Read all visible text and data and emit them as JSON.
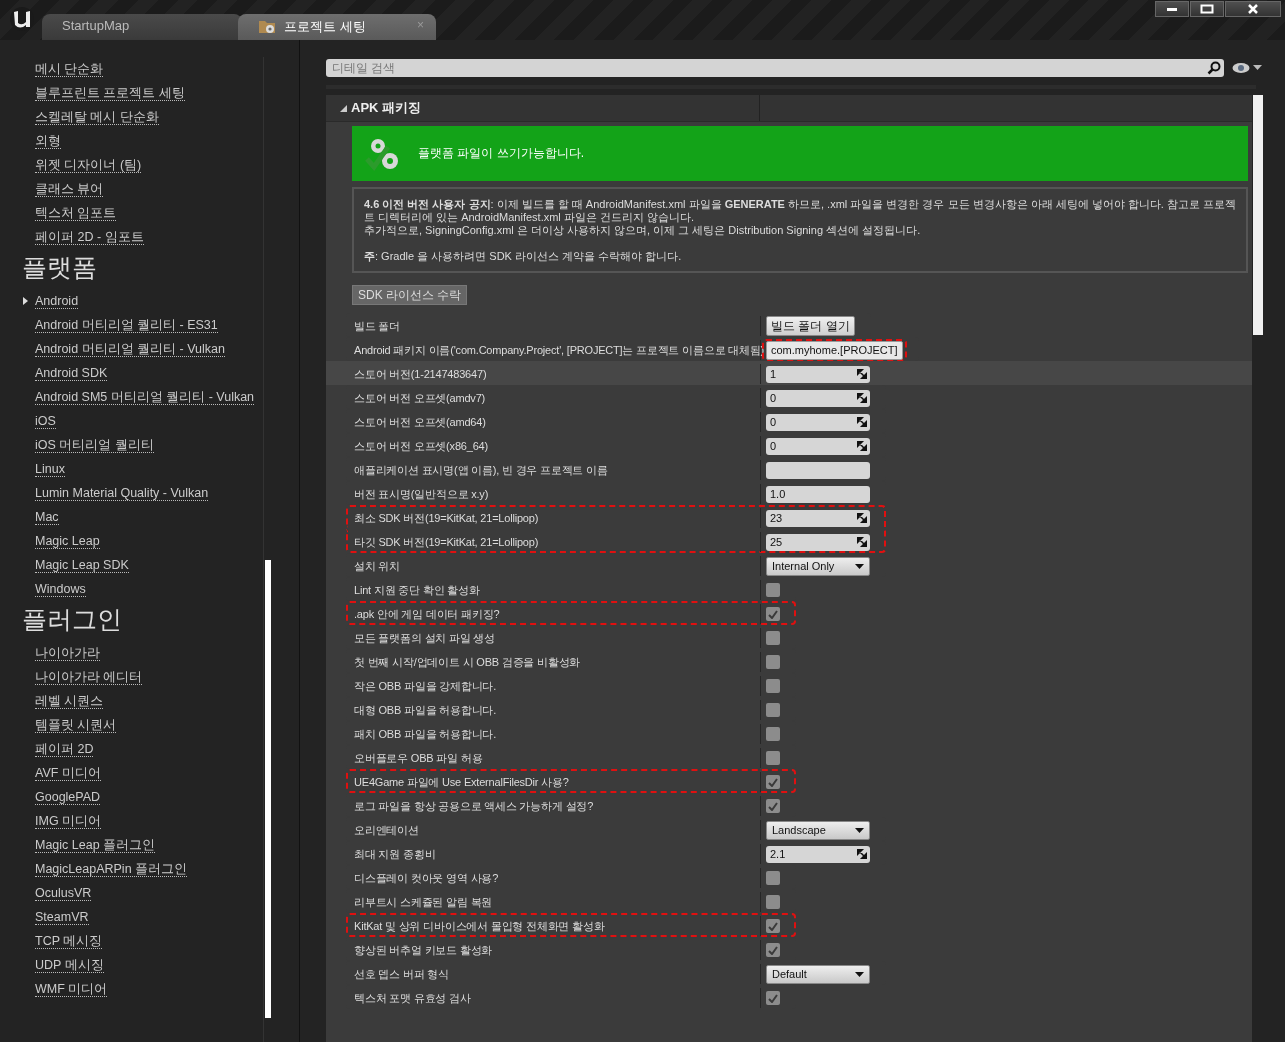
{
  "title_bar": {
    "tabs": [
      {
        "label": "StartupMap",
        "selected": false
      },
      {
        "label": "프로젝트 세팅",
        "selected": true,
        "close_label": "×"
      }
    ]
  },
  "sidebar": {
    "groups": [
      {
        "items": [
          {
            "label": "메시 단순화",
            "kind": "link"
          },
          {
            "label": "블루프린트 프로젝트 세팅",
            "kind": "link"
          },
          {
            "label": "스켈레탈 메시 단순화",
            "kind": "link"
          },
          {
            "label": "외형",
            "kind": "link"
          },
          {
            "label": "위젯 디자이너 (팀)",
            "kind": "link"
          },
          {
            "label": "클래스 뷰어",
            "kind": "link"
          },
          {
            "label": "텍스처 임포트",
            "kind": "link"
          },
          {
            "label": "페이퍼 2D - 임포트",
            "kind": "link"
          }
        ]
      },
      {
        "heading": "플랫폼",
        "items": [
          {
            "label": "Android",
            "kind": "expandable"
          },
          {
            "label": "Android 머티리얼 퀄리티 - ES31",
            "kind": "link"
          },
          {
            "label": "Android 머티리얼 퀄리티 - Vulkan",
            "kind": "link"
          },
          {
            "label": "Android SDK",
            "kind": "link"
          },
          {
            "label": "Android SM5 머티리얼 퀄리티 - Vulkan",
            "kind": "link"
          },
          {
            "label": "iOS",
            "kind": "link"
          },
          {
            "label": "iOS 머티리얼 퀄리티",
            "kind": "link"
          },
          {
            "label": "Linux",
            "kind": "link"
          },
          {
            "label": "Lumin Material Quality - Vulkan",
            "kind": "link"
          },
          {
            "label": "Mac",
            "kind": "link"
          },
          {
            "label": "Magic Leap",
            "kind": "link"
          },
          {
            "label": "Magic Leap SDK",
            "kind": "link"
          },
          {
            "label": "Windows",
            "kind": "link"
          }
        ]
      },
      {
        "heading": "플러그인",
        "items": [
          {
            "label": "나이아가라",
            "kind": "link"
          },
          {
            "label": "나이아가라 에디터",
            "kind": "link"
          },
          {
            "label": "레벨 시퀀스",
            "kind": "link"
          },
          {
            "label": "템플릿 시퀀서",
            "kind": "link"
          },
          {
            "label": "페이퍼 2D",
            "kind": "link"
          },
          {
            "label": "AVF 미디어",
            "kind": "link"
          },
          {
            "label": "GooglePAD",
            "kind": "link"
          },
          {
            "label": "IMG 미디어",
            "kind": "link"
          },
          {
            "label": "Magic Leap 플러그인",
            "kind": "link"
          },
          {
            "label": "MagicLeapARPin 플러그인",
            "kind": "link"
          },
          {
            "label": "OculusVR",
            "kind": "link"
          },
          {
            "label": "SteamVR",
            "kind": "link"
          },
          {
            "label": "TCP 메시징",
            "kind": "link"
          },
          {
            "label": "UDP 메시징",
            "kind": "link"
          },
          {
            "label": "WMF 미디어",
            "kind": "link"
          }
        ]
      }
    ]
  },
  "details": {
    "search": {
      "placeholder": "디테일 검색"
    },
    "category": {
      "label": "APK 패키징",
      "expanded": true
    },
    "banner": {
      "text": "플랫폼 파일이 쓰기가능합니다."
    },
    "notice": [
      "**4.6 이전 버전 사용자 공지**: 이제 빌드를 할 때 AndroidManifest.xml 파일을 **GENERATE** 하므로, .xml 파일을 변경한 경우 모든 변경사항은 아래 세팅에 넣어야 합니다. 참고로 프로젝트 디렉터리에 있는 AndroidManifest.xml 파일은 건드리지 않습니다.",
      "추가적으로, SigningConfig.xml 은 더이상 사용하지 않으며, 이제 그 세팅은 Distribution Signing 섹션에 설정됩니다.",
      "**주**: Gradle 을 사용하려면 SDK 라이선스 계약을 수락해야 합니다."
    ],
    "license_button": "SDK 라이선스 수락",
    "rows": [
      {
        "kind": "button",
        "label": "빌드 폴더",
        "value": "빌드 폴더 열기",
        "value_highlighted": false,
        "row_highlighted": false,
        "hovered": false
      },
      {
        "kind": "text",
        "label": "Android 패키지 이름('com.Company.Project', [PROJECT]는 프로젝트 이름으로 대체됨)",
        "value": "com.myhome.[PROJECT]",
        "value_highlighted": true,
        "row_highlighted": false,
        "hovered": false
      },
      {
        "kind": "number",
        "label": "스토어 버전(1-2147483647)",
        "value": "1",
        "value_highlighted": false,
        "row_highlighted": false,
        "hovered": true
      },
      {
        "kind": "number",
        "label": "스토어 버전 오프셋(amdv7)",
        "value": "0",
        "value_highlighted": false,
        "row_highlighted": false,
        "hovered": false
      },
      {
        "kind": "number",
        "label": "스토어 버전 오프셋(amd64)",
        "value": "0",
        "value_highlighted": false,
        "row_highlighted": false,
        "hovered": false
      },
      {
        "kind": "number",
        "label": "스토어 버전 오프셋(x86_64)",
        "value": "0",
        "value_highlighted": false,
        "row_highlighted": false,
        "hovered": false
      },
      {
        "kind": "text",
        "label": "애플리케이션 표시명(앱 이름), 빈 경우 프로젝트 이름",
        "value_highlighted": false,
        "row_highlighted": false,
        "hovered": false
      },
      {
        "kind": "text",
        "label": "버전 표시명(일반적으로 x.y)",
        "value": "1.0",
        "value_highlighted": false,
        "row_highlighted": false,
        "hovered": false
      },
      {
        "kind": "number",
        "label": "최소 SDK 버전(19=KitKat, 21=Lollipop)",
        "value": "23",
        "value_highlighted": false,
        "row_highlighted": true,
        "hovered": false
      },
      {
        "kind": "number",
        "label": "타깃 SDK 버전(19=KitKat, 21=Lollipop)",
        "value": "25",
        "value_highlighted": false,
        "row_highlighted": true,
        "hovered": false
      },
      {
        "kind": "dropdown",
        "label": "설치 위치",
        "value": "Internal Only",
        "value_highlighted": false,
        "row_highlighted": false,
        "hovered": false
      },
      {
        "kind": "checkbox",
        "label": "Lint 지원 중단 확인 활성화",
        "checked": false,
        "value_highlighted": false,
        "row_highlighted": false,
        "hovered": false
      },
      {
        "kind": "checkbox",
        "label": ".apk 안에 게임 데이터 패키징?",
        "checked": true,
        "value_highlighted": false,
        "row_highlighted": true,
        "hovered": false
      },
      {
        "kind": "checkbox",
        "label": "모든 플랫폼의 설치 파일 생성",
        "checked": false,
        "value_highlighted": false,
        "row_highlighted": false,
        "hovered": false
      },
      {
        "kind": "checkbox",
        "label": "첫 번째 시작/업데이트 시 OBB 검증을 비활성화",
        "checked": false,
        "value_highlighted": false,
        "row_highlighted": false,
        "hovered": false
      },
      {
        "kind": "checkbox",
        "label": "작은 OBB 파일을 강제합니다.",
        "checked": false,
        "value_highlighted": false,
        "row_highlighted": false,
        "hovered": false
      },
      {
        "kind": "checkbox",
        "label": "대형 OBB 파일을 허용합니다.",
        "checked": false,
        "value_highlighted": false,
        "row_highlighted": false,
        "hovered": false
      },
      {
        "kind": "checkbox",
        "label": "패치 OBB 파일을 허용합니다.",
        "checked": false,
        "value_highlighted": false,
        "row_highlighted": false,
        "hovered": false
      },
      {
        "kind": "checkbox",
        "label": "오버플로우 OBB 파일 허용",
        "checked": false,
        "value_highlighted": false,
        "row_highlighted": false,
        "hovered": false
      },
      {
        "kind": "checkbox",
        "label": "UE4Game 파일에 Use ExternalFilesDir 사용?",
        "checked": true,
        "value_highlighted": false,
        "row_highlighted": true,
        "hovered": false
      },
      {
        "kind": "checkbox",
        "label": "로그 파일을 항상 공용으로 액세스 가능하게 설정?",
        "checked": true,
        "value_highlighted": false,
        "row_highlighted": false,
        "hovered": false
      },
      {
        "kind": "dropdown",
        "label": "오리엔테이션",
        "value": "Landscape",
        "value_highlighted": false,
        "row_highlighted": false,
        "hovered": false
      },
      {
        "kind": "number",
        "label": "최대 지원 종횡비",
        "value": "2.1",
        "value_highlighted": false,
        "row_highlighted": false,
        "hovered": false
      },
      {
        "kind": "checkbox",
        "label": "디스플레이 컷아웃 영역 사용?",
        "checked": false,
        "value_highlighted": false,
        "row_highlighted": false,
        "hovered": false
      },
      {
        "kind": "checkbox",
        "label": "리부트시 스케쥴된 알림 복원",
        "checked": false,
        "value_highlighted": false,
        "row_highlighted": false,
        "hovered": false
      },
      {
        "kind": "checkbox",
        "label": "KitKat 및 상위 디바이스에서 몰입형 전체화면 활성화",
        "checked": true,
        "value_highlighted": false,
        "row_highlighted": true,
        "hovered": false
      },
      {
        "kind": "checkbox",
        "label": "향상된 버추얼 키보드 활성화",
        "checked": true,
        "value_highlighted": false,
        "row_highlighted": false,
        "hovered": false
      },
      {
        "kind": "dropdown",
        "label": "선호 뎁스 버퍼 형식",
        "value": "Default",
        "value_highlighted": false,
        "row_highlighted": false,
        "hovered": false
      },
      {
        "kind": "checkbox",
        "label": "텍스처 포맷 유효성 검사",
        "checked": true,
        "value_highlighted": false,
        "row_highlighted": false,
        "hovered": false
      }
    ]
  }
}
